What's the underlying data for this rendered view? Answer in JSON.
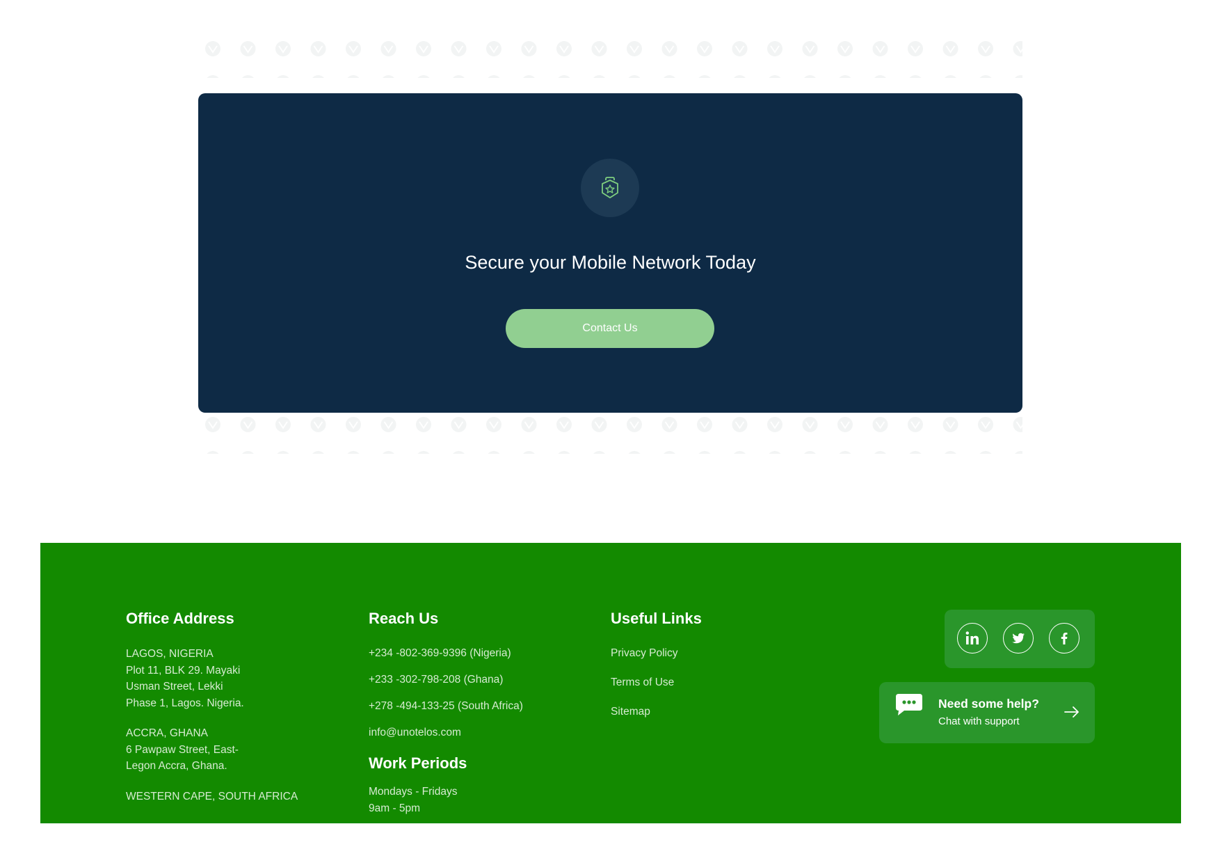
{
  "cta": {
    "title": "Secure your Mobile Network Today",
    "button_label": "Contact Us",
    "icon": "shield-star-icon"
  },
  "footer": {
    "office": {
      "heading": "Office Address",
      "lagos": [
        "LAGOS, NIGERIA",
        "Plot 11, BLK 29. Mayaki",
        "Usman Street, Lekki",
        "Phase 1, Lagos. Nigeria."
      ],
      "accra": [
        "ACCRA, GHANA",
        "6 Pawpaw Street, East-",
        "Legon Accra, Ghana."
      ],
      "cape": [
        "WESTERN CAPE, SOUTH AFRICA"
      ]
    },
    "reach": {
      "heading": "Reach Us",
      "phones": [
        "+234 -802-369-9396 (Nigeria)",
        "+233 -302-798-208 (Ghana)",
        "+278 -494-133-25 (South Africa)"
      ],
      "email": "info@unotelos.com"
    },
    "work": {
      "heading": "Work Periods",
      "days": "Mondays - Fridays",
      "hours": "9am - 5pm"
    },
    "links": {
      "heading": "Useful Links",
      "items": [
        "Privacy Policy",
        "Terms of Use",
        "Sitemap"
      ]
    },
    "social": [
      "linkedin-icon",
      "twitter-icon",
      "facebook-icon"
    ],
    "help": {
      "title": "Need some help?",
      "subtitle": "Chat with support"
    }
  },
  "colors": {
    "cta_bg": "#0e2a45",
    "cta_button": "#91cf91",
    "footer_bg": "#138a00",
    "footer_card": "#2a962b"
  }
}
